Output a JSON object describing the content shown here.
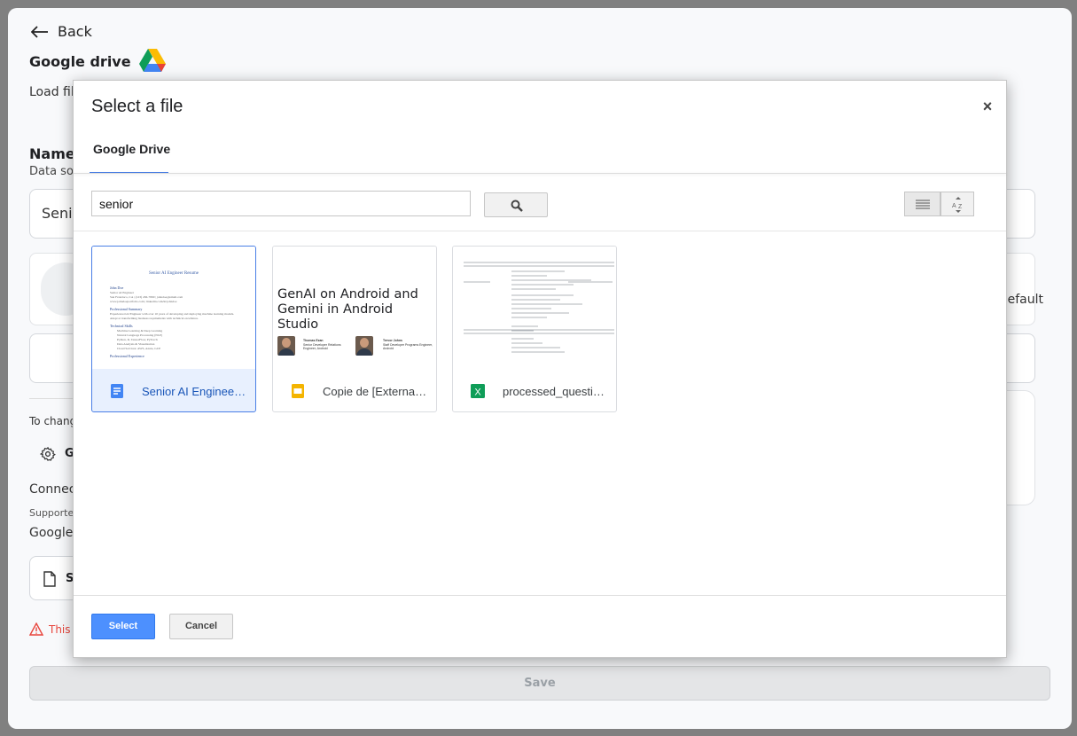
{
  "background": {
    "back_label": "Back",
    "title": "Google drive",
    "load_text": "Load file",
    "name_label": "Name",
    "datasource_label": "Data sou",
    "name_value": "Senio",
    "default_label": "efault",
    "change_text": "To change",
    "gear_text": "G",
    "connect_text": "Connect",
    "supported_text": "Supporte",
    "gs_text": "Google S",
    "file_label": "S",
    "warning_text": "This f",
    "save_label": "Save"
  },
  "modal": {
    "title": "Select a file",
    "close_glyph": "×",
    "tab_label": "Google Drive",
    "search_value": "senior",
    "files": [
      {
        "name": "Senior AI Engineer Resume",
        "type": "doc",
        "selected": true,
        "thumb": {
          "title": "Senior AI Engineer Resume",
          "name": "John Doe",
          "role": "Senior AI Engineer",
          "contact": "San Francisco, CA | (123) 456-7890 | johndoe@email.com",
          "links": "www.johndoeportfolio.com | linkedin.com/in/johndoe",
          "summary_heading": "Professional Summary",
          "summary_text": "Experienced AI Engineer with over 10 years of developing and deploying machine learning models. Adept at transforming business requirements with technical excellence.",
          "skills_heading": "Technical Skills",
          "skills": [
            "Machine Learning & Deep Learning",
            "Natural Language Processing (NLP)",
            "Python, R, TensorFlow, PyTorch",
            "Data Analysis & Visualization",
            "Cloud Services: AWS, Azure, GCP"
          ],
          "exp_heading": "Professional Experience"
        }
      },
      {
        "name": "Copie de [External] GenAI on Android",
        "type": "slides",
        "selected": false,
        "thumb": {
          "title": "GenAI on Android and Gemini in Android Studio",
          "p1_name": "Thomas Ezan",
          "p1_role": "Senior Developer Relations Engineer, Android",
          "p2_name": "Trevor Johns",
          "p2_role": "Staff Developer Programs Engineer, Android"
        }
      },
      {
        "name": "processed_questions",
        "type": "sheet",
        "selected": false
      }
    ],
    "select_label": "Select",
    "cancel_label": "Cancel"
  },
  "colors": {
    "accent": "#4d90fe",
    "tab_underline": "#4a7fe6",
    "selected_tile_bg": "#e8f0fe",
    "doc_icon": "#4285f4",
    "slides_icon": "#f4b400",
    "sheet_icon": "#0f9d58",
    "warning": "#e8453c"
  }
}
